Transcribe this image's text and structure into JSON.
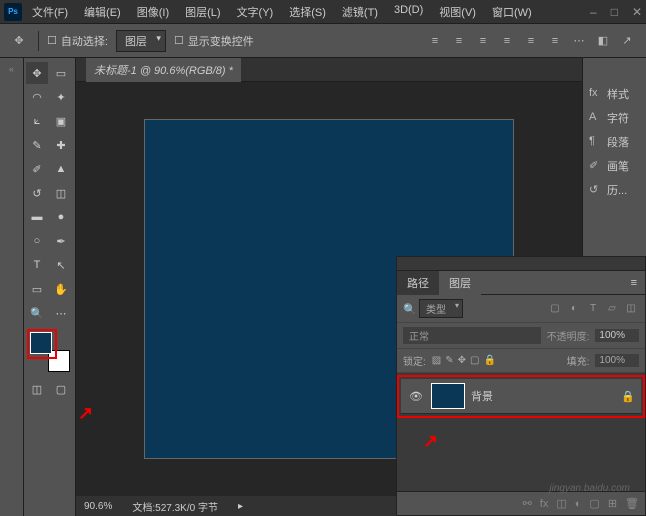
{
  "app": {
    "logo": "Ps"
  },
  "menu": [
    "文件(F)",
    "编辑(E)",
    "图像(I)",
    "图层(L)",
    "文字(Y)",
    "选择(S)",
    "滤镜(T)",
    "3D(D)",
    "视图(V)",
    "窗口(W)"
  ],
  "options": {
    "auto_select": "自动选择:",
    "layer_dd": "图层",
    "show_transform": "显示变换控件"
  },
  "document": {
    "tab": "未标题-1 @ 90.6%(RGB/8) *",
    "canvas_color": "#0a3756"
  },
  "status": {
    "zoom": "90.6%",
    "doc_info": "文档:527.3K/0 字节"
  },
  "right_panels": [
    "样式",
    "字符",
    "段落",
    "画笔",
    "历..."
  ],
  "layers_panel": {
    "tabs": [
      "路径",
      "图层"
    ],
    "filter_label": "类型",
    "blend_mode": "正常",
    "opacity_label": "不透明度:",
    "opacity_val": "100%",
    "lock_label": "锁定:",
    "fill_label": "填充:",
    "fill_val": "100%",
    "layers": [
      {
        "name": "背景",
        "locked": true,
        "visible": true
      }
    ]
  },
  "watermark": "jingyan.baidu.com"
}
